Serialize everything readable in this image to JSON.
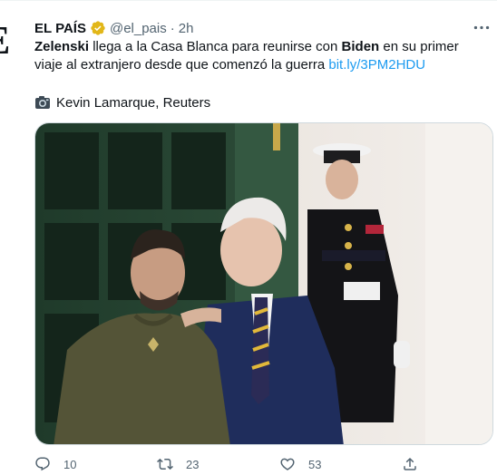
{
  "tweet": {
    "avatar_letter": "E",
    "author_name": "EL PAÍS",
    "handle": "@el_pais",
    "separator": "·",
    "time": "2h",
    "text_parts": {
      "p1": "Zelenski",
      "p2": " llega a la Casa Blanca para reunirse con ",
      "p3": "Biden",
      "p4": " en su primer viaje al extranjero desde que comenzó la guerra ",
      "link": "bit.ly/3PM2HDU"
    },
    "photo_credit": "Kevin Lamarque, Reuters",
    "actions": {
      "replies": "10",
      "retweets": "23",
      "likes": "53"
    }
  },
  "icons": {
    "verified": "verified-badge-icon",
    "more": "more-options-icon",
    "camera": "camera-icon",
    "reply": "reply-icon",
    "retweet": "retweet-icon",
    "like": "like-icon",
    "share": "share-icon"
  },
  "colors": {
    "text": "#0f1419",
    "secondary": "#536471",
    "link": "#1d9bf0",
    "verified": "#e2b719"
  }
}
